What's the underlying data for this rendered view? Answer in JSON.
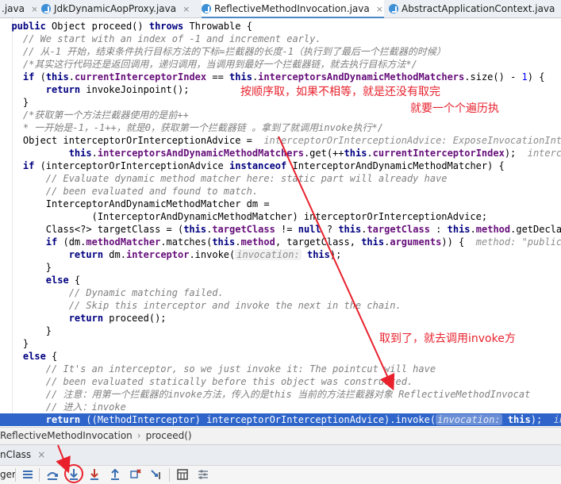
{
  "tabs": [
    {
      "label": ".java",
      "active": false
    },
    {
      "label": "JdkDynamicAopProxy.java",
      "active": false
    },
    {
      "label": "ReflectiveMethodInvocation.java",
      "active": true
    },
    {
      "label": "AbstractApplicationContext.java",
      "active": false
    }
  ],
  "code": {
    "l01_kw1": "public",
    "l01_a": " Object proceed() ",
    "l01_kw2": "throws",
    "l01_b": " Throwable {",
    "l02": "    // We start with an index of -1 and increment early.",
    "l03": "    // 从-1 开始，结束条件执行目标方法的下标=拦截器的长度-1（执行到了最后一个拦截器的时候）",
    "l04": "    /*其实这行代码还是返回调用，递归调用，当调用到最好一个拦截器链，就去执行目标方法*/",
    "l05_kw1": "if",
    "l05_a": " (",
    "l05_kw2": "this",
    "l05_b": ".",
    "l05_f1": "currentInterceptorIndex",
    "l05_c": " == ",
    "l05_kw3": "this",
    "l05_d": ".",
    "l05_f2": "interceptorsAndDynamicMethodMatchers",
    "l05_e": ".size() - ",
    "l05_num": "1",
    "l05_g": ") {",
    "l06_kw": "return",
    "l06_a": " invokeJoinpoint();",
    "l07": "    }",
    "l08": "    /*获取第一个方法拦截器使用的是前++",
    "l09": "    * 一开始是-1，-1++，就是0，获取第一个拦截器链 。拿到了就调用invoke执行*/",
    "l10_a": "    Object interceptorOrInterceptionAdvice = ",
    "l10_inl": " interceptorOrInterceptionAdvice: ExposeInvocationInt",
    "l11_a": "            ",
    "l11_kw1": "this",
    "l11_b": ".",
    "l11_f1": "interceptorsAndDynamicMethodMatchers",
    "l11_c": ".get(++",
    "l11_kw2": "this",
    "l11_d": ".",
    "l11_f2": "currentInterceptorIndex",
    "l11_e": ");  ",
    "l11_inl": "interc",
    "l12_kw1": "if",
    "l12_a": " (interceptorOrInterceptionAdvice ",
    "l12_kw2": "instanceof",
    "l12_b": " InterceptorAndDynamicMethodMatcher) {",
    "l13": "        // Evaluate dynamic method matcher here: static part will already have",
    "l14": "        // been evaluated and found to match.",
    "l15": "        InterceptorAndDynamicMethodMatcher dm =",
    "l16": "                (InterceptorAndDynamicMethodMatcher) interceptorOrInterceptionAdvice;",
    "l17_a": "        Class<?> targetClass = (",
    "l17_kw1": "this",
    "l17_b": ".",
    "l17_f1": "targetClass",
    "l17_c": " != ",
    "l17_kw2": "null",
    "l17_d": " ? ",
    "l17_kw3": "this",
    "l17_e": ".",
    "l17_f2": "targetClass",
    "l17_g": " : ",
    "l17_kw4": "this",
    "l17_h": ".",
    "l17_f3": "method",
    "l17_i": ".getDecla",
    "l18_kw1": "if",
    "l18_a": " (dm.",
    "l18_f1": "methodMatcher",
    "l18_b": ".matches(",
    "l18_kw2": "this",
    "l18_c": ".",
    "l18_f2": "method",
    "l18_d": ", targetClass, ",
    "l18_kw3": "this",
    "l18_e": ".",
    "l18_f3": "arguments",
    "l18_g": ")) {  ",
    "l18_inl": "method: \"public",
    "l19_kw1": "return",
    "l19_a": " dm.",
    "l19_f1": "interceptor",
    "l19_b": ".invoke(",
    "l19_hint": "invocation:",
    "l19_c": " ",
    "l19_kw2": "this",
    "l19_d": ");",
    "l20": "        }",
    "l21_kw": "else",
    "l21_a": " {",
    "l22": "            // Dynamic matching failed.",
    "l23": "            // Skip this interceptor and invoke the next in the chain.",
    "l24_kw": "return",
    "l24_a": " proceed();",
    "l25": "        }",
    "l26": "    }",
    "l27_kw": "else",
    "l27_a": " {",
    "l28": "        // It's an interceptor, so we just invoke it: The pointcut will have",
    "l29": "        // been evaluated statically before this object was constructed.",
    "l30": "        // 注意：用第一个拦截器的invoke方法，传入的是this 当前的方法拦截器对象 ReflectiveMethodInvocat",
    "l31": "        // 进入：invoke",
    "l32_a": "        ",
    "l32_kw1": "return",
    "l32_b": " ((MethodInterceptor) interceptorOrInterceptionAdvice).invoke(",
    "l32_hint": "invocation:",
    "l32_c": " ",
    "l32_kw2": "this",
    "l32_d": ");  ",
    "l32_inl": "inte"
  },
  "annotations": {
    "a1": "按顺序取，如果不相等，就是还没有取完",
    "a2": "就要一个个遍历执",
    "a3": "取到了，就去调用invoke方"
  },
  "breadcrumb": {
    "first": "ReflectiveMethodInvocation",
    "sep": "›",
    "second": "proceed()"
  },
  "panel": {
    "tab_label": "nClass",
    "close": "×"
  },
  "toolbar": {
    "left_label": "ger"
  },
  "colors": {
    "selection": "#2f65ca",
    "annotation_red": "#e8212d",
    "keyword": "#000080",
    "field": "#660e7a",
    "comment": "#808080"
  }
}
